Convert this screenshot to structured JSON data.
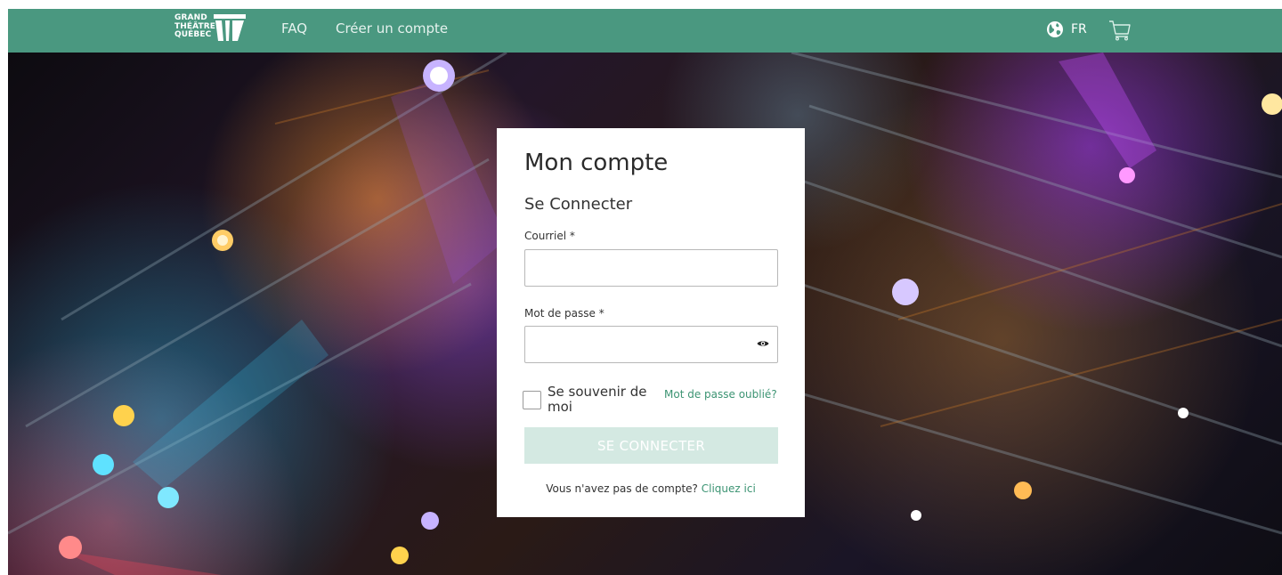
{
  "header": {
    "logo_lines": [
      "GRAND",
      "THÉÂTRE",
      "QUÉBEC"
    ],
    "nav": {
      "faq": "FAQ",
      "create_account": "Créer un compte"
    },
    "language": "FR",
    "brand_color": "#4a9880"
  },
  "login": {
    "title": "Mon compte",
    "subtitle": "Se Connecter",
    "email_label": "Courriel *",
    "email_value": "",
    "password_label": "Mot de passe *",
    "password_value": "",
    "remember_label": "Se souvenir de moi",
    "remember_checked": false,
    "forgot_link": "Mot de passe oublié?",
    "submit_label": "SE CONNECTER",
    "no_account_text": "Vous n'avez pas de compte?",
    "signup_link": "Cliquez ici",
    "accent_color": "#3c9473"
  },
  "icons": {
    "globe": "globe-icon",
    "cart": "cart-icon",
    "eye": "eye-icon",
    "logo": "grand-theatre-logo"
  }
}
